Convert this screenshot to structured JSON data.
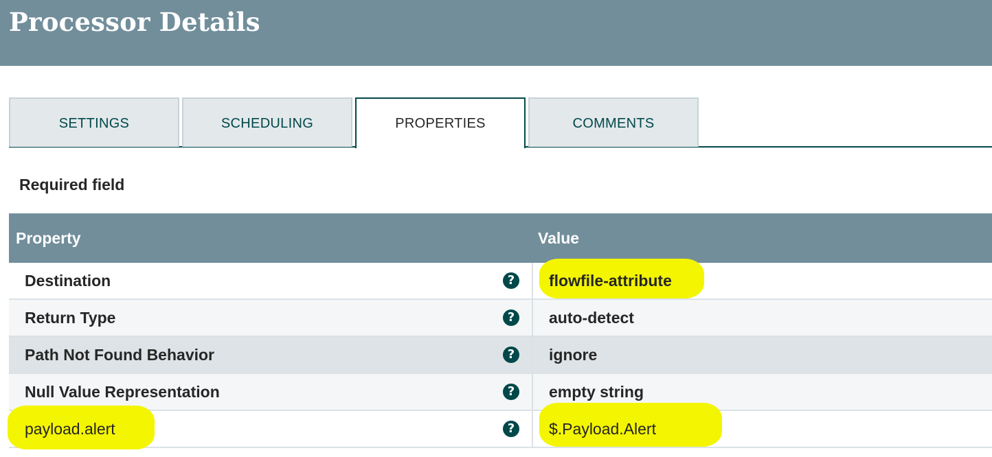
{
  "header": {
    "title": "Processor Details"
  },
  "tabs": [
    {
      "label": "SETTINGS",
      "active": false
    },
    {
      "label": "SCHEDULING",
      "active": false
    },
    {
      "label": "PROPERTIES",
      "active": true
    },
    {
      "label": "COMMENTS",
      "active": false
    }
  ],
  "required_label": "Required field",
  "grid": {
    "columns": [
      "Property",
      "Value"
    ],
    "rows": [
      {
        "property": "Destination",
        "value": "flowfile-attribute",
        "required": true,
        "help": "?"
      },
      {
        "property": "Return Type",
        "value": "auto-detect",
        "required": true,
        "help": "?"
      },
      {
        "property": "Path Not Found Behavior",
        "value": "ignore",
        "required": true,
        "help": "?"
      },
      {
        "property": "Null Value Representation",
        "value": "empty string",
        "required": true,
        "help": "?"
      },
      {
        "property": "payload.alert",
        "value": "$.Payload.Alert",
        "required": false,
        "help": "?"
      }
    ]
  },
  "colors": {
    "header_bg": "#728e9b",
    "accent": "#004849",
    "highlight": "#f4f500"
  },
  "icons": {
    "help": "question-circle-icon"
  }
}
